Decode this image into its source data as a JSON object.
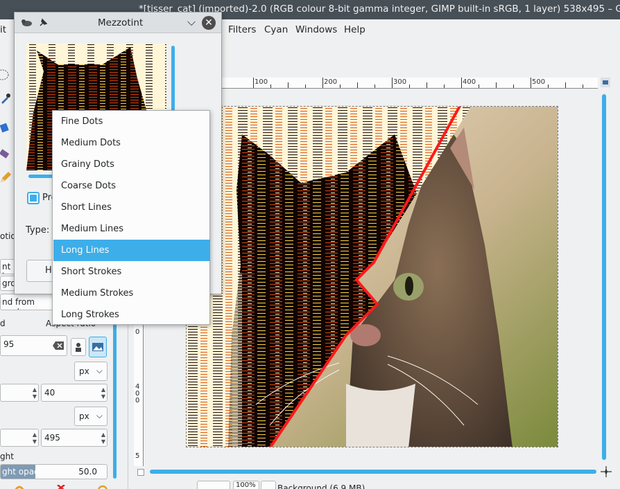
{
  "window": {
    "title": "*[tisser_cat] (imported)-2.0 (RGB colour 8-bit gamma integer, GIMP built-in sRGB, 1 layer) 538x495 – GIMP"
  },
  "menubar": {
    "partial_left": "it",
    "items": [
      "Filters",
      "Cyan",
      "Windows",
      "Help"
    ]
  },
  "dialog": {
    "title": "Mezzotint",
    "preview_label": "Pre",
    "type_label": "Type:",
    "help_label": "He"
  },
  "type_menu": {
    "selected": "Long Lines",
    "options": [
      "Fine Dots",
      "Medium Dots",
      "Grainy Dots",
      "Coarse Dots",
      "Short Lines",
      "Medium Lines",
      "Long Lines",
      "Short Strokes",
      "Medium Strokes",
      "Long Strokes"
    ]
  },
  "tool_options": {
    "partial_options": "otion",
    "partial_nt_la": "nt la",
    "partial_gro": "gro",
    "expand_from_centre": "nd from centre",
    "fixed_partial": "d",
    "aspect_ratio": "Aspect ratio",
    "value_partial": "95",
    "position_y": "40",
    "unit_1": "px",
    "unit_2": "px",
    "size_h": "495",
    "highlight_partial": "ght",
    "opacity_label": "ght opacity",
    "opacity_value": "50.0"
  },
  "ruler": {
    "top_labels": [
      "100",
      "200",
      "300",
      "400",
      "500"
    ],
    "left_labels": [
      "0",
      "4",
      "0",
      "0",
      "5"
    ]
  },
  "statusbar": {
    "zoom": "100%",
    "layer": "Background (6.9 MB)"
  },
  "colors": {
    "accent": "#3daee9",
    "titlebar": "#475057",
    "panel": "#eff0f1",
    "red_line": "#ff1a1a"
  }
}
